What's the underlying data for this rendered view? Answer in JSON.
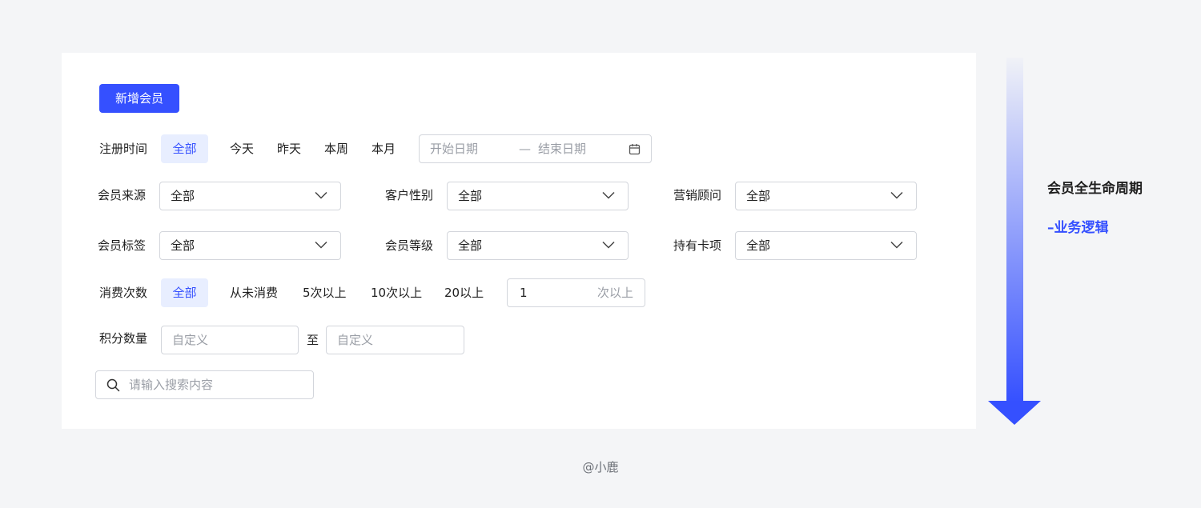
{
  "form": {
    "add_button": "新增会员",
    "register_time": {
      "label": "注册时间",
      "options": [
        "全部",
        "今天",
        "昨天",
        "本周",
        "本月"
      ],
      "start_placeholder": "开始日期",
      "separator": "—",
      "end_placeholder": "结束日期"
    },
    "member_source": {
      "label": "会员来源",
      "value": "全部"
    },
    "customer_gender": {
      "label": "客户性别",
      "value": "全部"
    },
    "sales_advisor": {
      "label": "营销顾问",
      "value": "全部"
    },
    "member_tag": {
      "label": "会员标签",
      "value": "全部"
    },
    "member_level": {
      "label": "会员等级",
      "value": "全部"
    },
    "card_item": {
      "label": "持有卡项",
      "value": "全部"
    },
    "consume_count": {
      "label": "消费次数",
      "options": [
        "全部",
        "从未消费",
        "5次以上",
        "10次以上",
        "20以上"
      ],
      "input_value": "1",
      "input_suffix": "次以上"
    },
    "points": {
      "label": "积分数量",
      "min_placeholder": "自定义",
      "to": "至",
      "max_placeholder": "自定义"
    },
    "search": {
      "placeholder": "请输入搜索内容"
    }
  },
  "side": {
    "title": "会员全生命周期",
    "subtitle": "–业务逻辑"
  },
  "credit": "@小鹿",
  "colors": {
    "accent": "#3550ff",
    "chip_bg": "#e8eeff",
    "border": "#d3d6dc",
    "page_bg": "#f4f5f7"
  }
}
